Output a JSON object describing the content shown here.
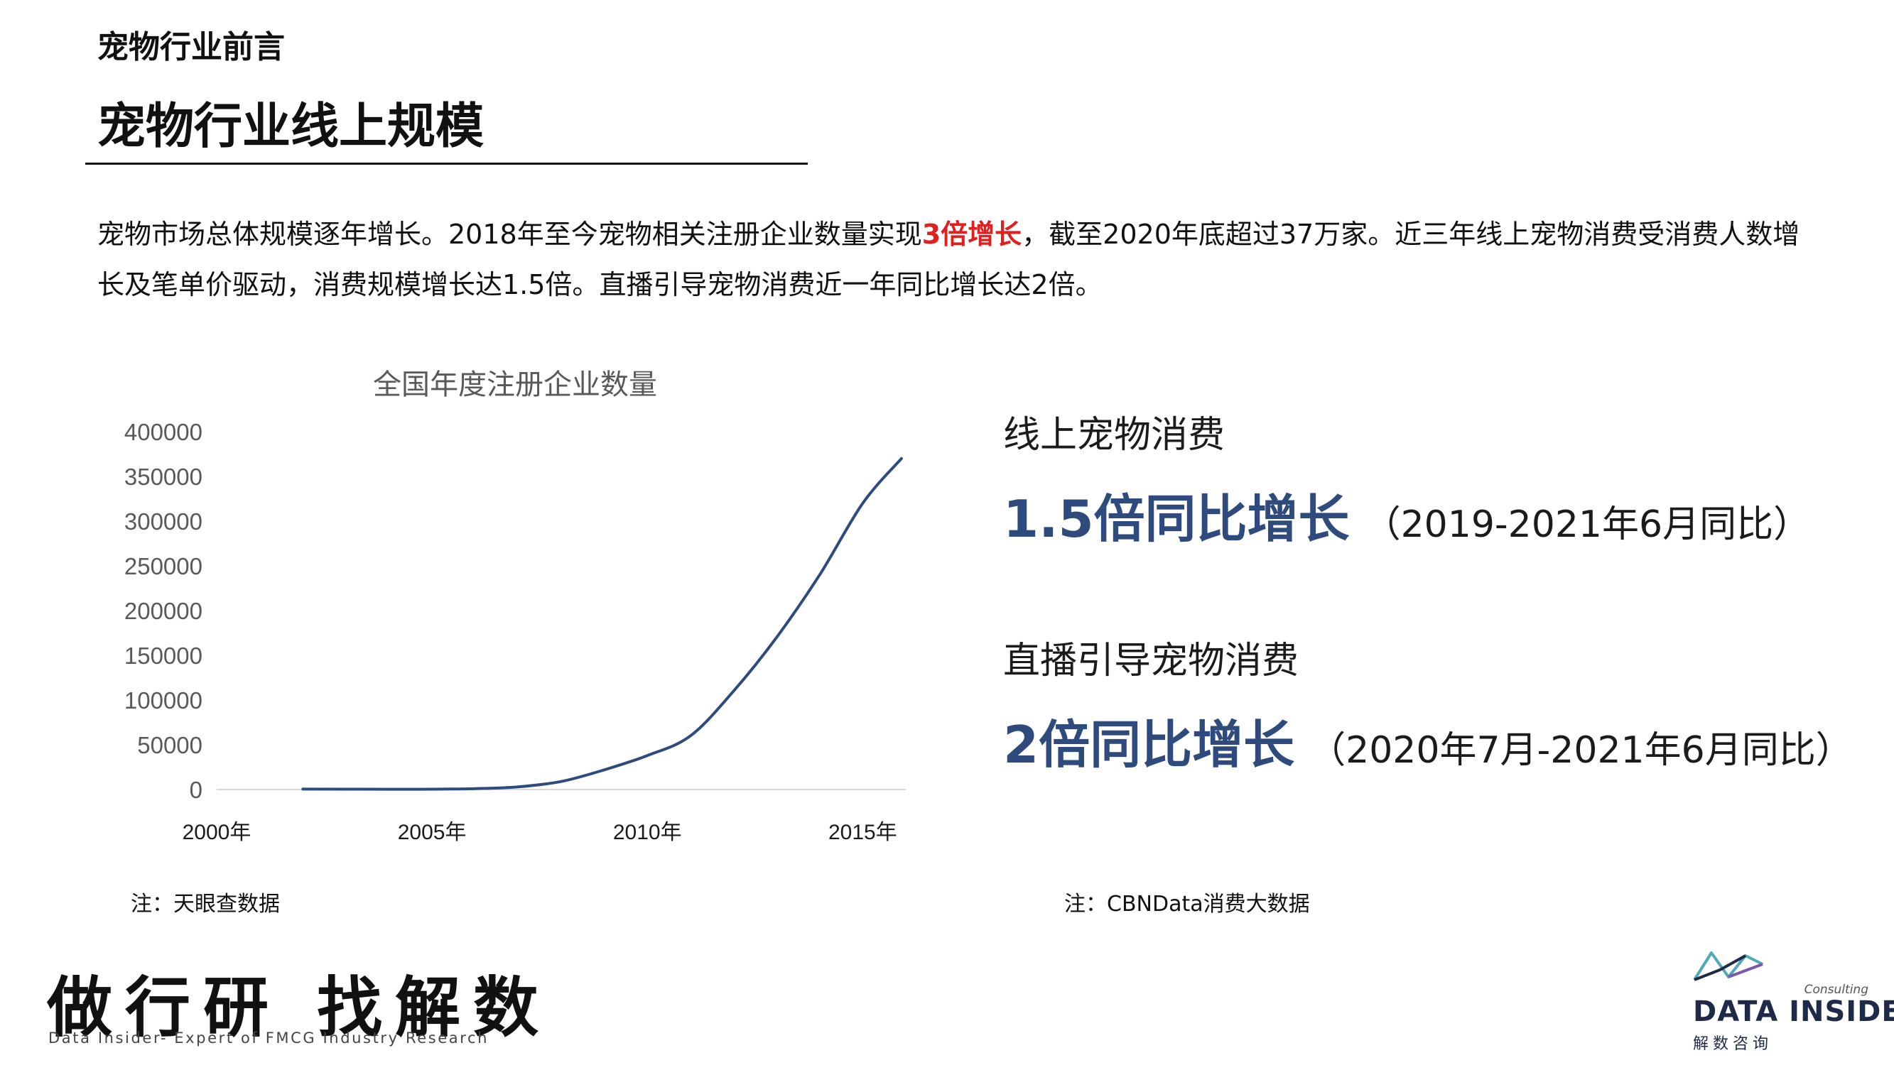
{
  "header": {
    "section": "宠物行业前言",
    "title": "宠物行业线上规模"
  },
  "intro": {
    "part1": "宠物市场总体规模逐年增长。2018年至今宠物相关注册企业数量实现",
    "highlight": "3倍增长",
    "part2": "，截至2020年底超过37万家。近三年线上宠物消费受消费人数增长及笔单价驱动，消费规模增长达1.5倍。直播引导宠物消费近一年同比增长达2倍。"
  },
  "chart_data": {
    "type": "line",
    "title": "全国年度注册企业数量",
    "xlabel": "",
    "ylabel": "",
    "x": [
      2002,
      2004,
      2005,
      2006,
      2007,
      2008,
      2009,
      2010,
      2011,
      2012,
      2013,
      2014,
      2015,
      2015.9
    ],
    "x_ticks": [
      "2000年",
      "2005年",
      "2010年",
      "2015年"
    ],
    "x_tick_values": [
      2000,
      2005,
      2010,
      2015
    ],
    "xlim": [
      2000,
      2016
    ],
    "ylim": [
      0,
      400000
    ],
    "y_ticks": [
      "0",
      "50000",
      "100000",
      "150000",
      "200000",
      "250000",
      "300000",
      "350000",
      "400000"
    ],
    "series": [
      {
        "values": [
          500,
          300,
          400,
          1000,
          3000,
          9000,
          22000,
          38000,
          60000,
          110000,
          170000,
          240000,
          320000,
          370000
        ],
        "color": "#2f4a7d"
      }
    ],
    "grid": false,
    "legend": "none"
  },
  "stats": [
    {
      "label": "线上宠物消费",
      "big": "1.5倍同比增长",
      "note": "（2019-2021年6月同比）"
    },
    {
      "label": "直播引导宠物消费",
      "big": "2倍同比增长",
      "note": "（2020年7月-2021年6月同比）"
    }
  ],
  "notes": {
    "left": "注：天眼查数据",
    "right": "注：CBNData消费大数据"
  },
  "footer": {
    "slogan": "做行研 找解数",
    "slogan_sub": "Data Insider- Expert of FMCG Industry Research",
    "logo_consulting": "Consulting",
    "logo_name": "DATA INSIDER",
    "logo_sub": "解数咨询"
  },
  "colors": {
    "accent": "#2f4a7d",
    "highlight": "#e02020"
  }
}
